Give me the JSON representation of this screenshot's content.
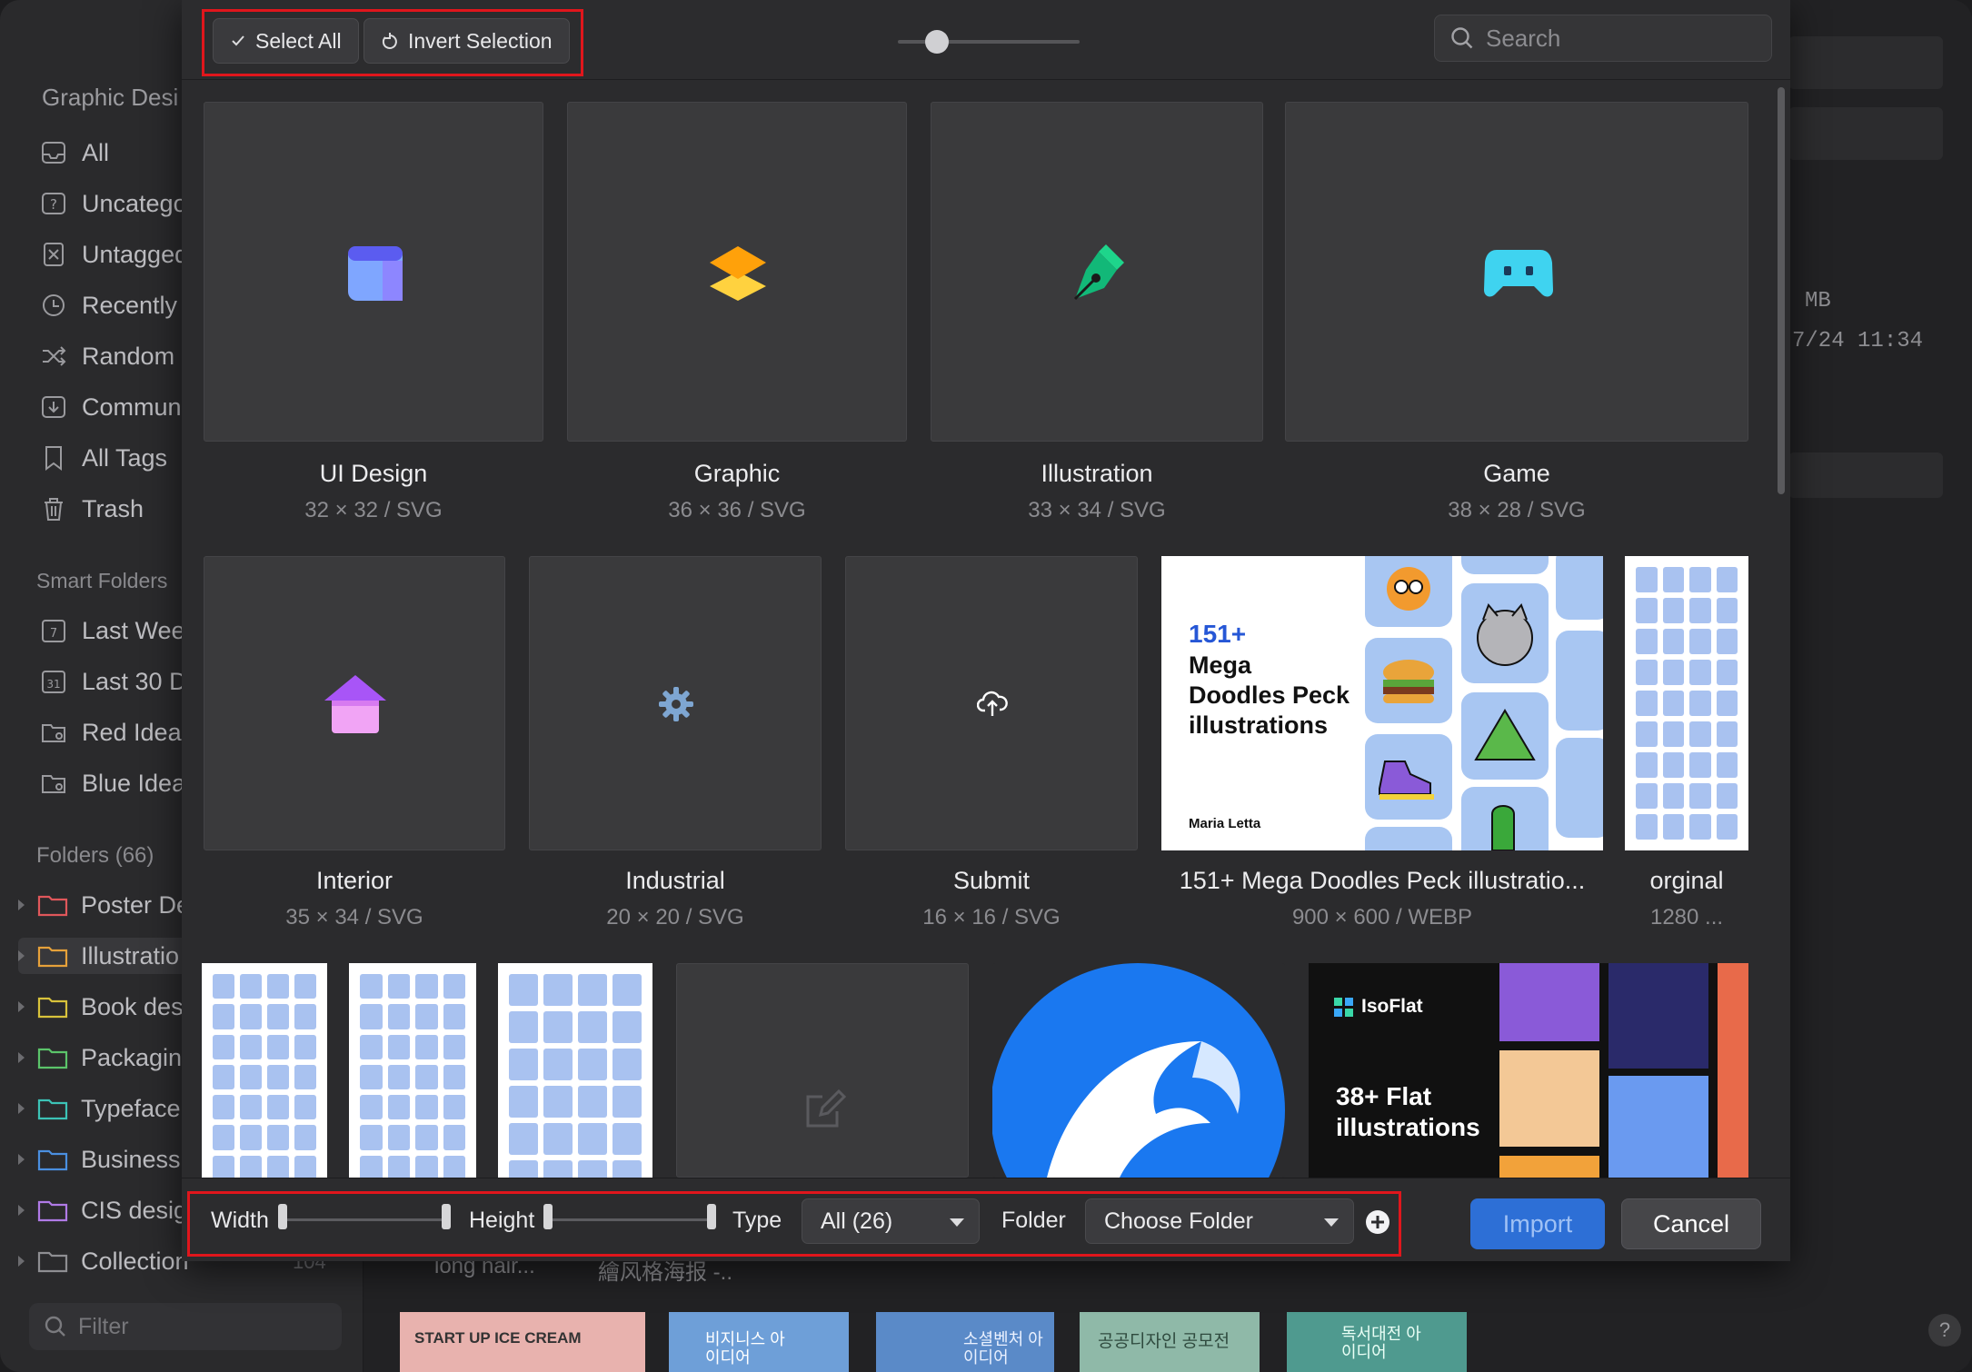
{
  "sidebar": {
    "library_title": "Graphic Desi",
    "items": [
      {
        "label": "All",
        "icon": "inbox-icon"
      },
      {
        "label": "Uncatego",
        "icon": "question-icon"
      },
      {
        "label": "Untagged",
        "icon": "untagged-icon"
      },
      {
        "label": "Recently",
        "icon": "clock-icon"
      },
      {
        "label": "Random",
        "icon": "shuffle-icon"
      },
      {
        "label": "Communi",
        "icon": "download-icon"
      },
      {
        "label": "All Tags",
        "icon": "bookmark-icon"
      },
      {
        "label": "Trash",
        "icon": "trash-icon"
      }
    ],
    "smart_folders_title": "Smart Folders",
    "smart_folders": [
      {
        "label": "Last Wee",
        "icon": "calendar-7-icon"
      },
      {
        "label": "Last 30 D",
        "icon": "calendar-31-icon"
      },
      {
        "label": "Red Ideas",
        "icon": "smart-folder-icon"
      },
      {
        "label": "Blue Idea",
        "icon": "smart-folder-icon"
      }
    ],
    "folders_title": "Folders (66)",
    "folders": [
      {
        "label": "Poster De",
        "color": "#e0575b"
      },
      {
        "label": "Illustratio",
        "color": "#e6a13a"
      },
      {
        "label": "Book des",
        "color": "#d8c23b"
      },
      {
        "label": "Packagin",
        "color": "#5bc46a"
      },
      {
        "label": "Typeface",
        "color": "#3cc3b6"
      },
      {
        "label": "Business",
        "color": "#4a8fe0"
      },
      {
        "label": "CIS desig",
        "color": "#b07ae6"
      },
      {
        "label": "Collection",
        "color": "#8e8e92"
      }
    ],
    "collection_count": "104",
    "filter_placeholder": "Filter"
  },
  "background": {
    "size_fragment": "MB",
    "date_fragment": "7/24 11:34",
    "bottom_labels": [
      "long hair...",
      "繪风格海报 -.."
    ],
    "bottom_thumbs": [
      "START UP ICE CREAM",
      "비지니스 아이디어",
      "소셜벤처 아이디어",
      "공공디자인 공모전",
      "독서대전 아이디어"
    ],
    "help": "?"
  },
  "toolbar": {
    "select_all": "Select All",
    "invert_selection": "Invert Selection",
    "search_placeholder": "Search"
  },
  "items": [
    {
      "name": "UI Design",
      "meta": "32 × 32 / SVG",
      "icon": "ui-design-icon"
    },
    {
      "name": "Graphic",
      "meta": "36 × 36 / SVG",
      "icon": "layers-icon"
    },
    {
      "name": "Illustration",
      "meta": "33 × 34 / SVG",
      "icon": "pen-nib-icon"
    },
    {
      "name": "Game",
      "meta": "38 × 28 / SVG",
      "icon": "gamepad-icon"
    },
    {
      "name": "Interior",
      "meta": "35 × 34 / SVG",
      "icon": "house-icon"
    },
    {
      "name": "Industrial",
      "meta": "20 × 20 / SVG",
      "icon": "gear-icon"
    },
    {
      "name": "Submit",
      "meta": "16 × 16 / SVG",
      "icon": "cloud-upload-icon"
    },
    {
      "name": "151+ Mega Doodles Peck illustratio...",
      "meta": "900 × 600 / WEBP",
      "icon": "thumbnail"
    },
    {
      "name": "orginal",
      "meta": "1280 ...",
      "icon": "thumbnail"
    }
  ],
  "doodles_thumb": {
    "number": "151+",
    "title_line1": "Mega",
    "title_line2": "Doodles Peck",
    "title_line3": "illustrations",
    "author": "Maria Letta"
  },
  "isoflat_thumb": {
    "brand": "IsoFlat",
    "line1": "38+ Flat",
    "line2": "illustrations"
  },
  "bottom": {
    "width_label": "Width",
    "height_label": "Height",
    "type_label": "Type",
    "type_value": "All (26)",
    "folder_label": "Folder",
    "folder_value": "Choose Folder",
    "import": "Import",
    "cancel": "Cancel"
  },
  "colors": {
    "accent": "#2d6fd6",
    "highlight": "#e0161c"
  }
}
